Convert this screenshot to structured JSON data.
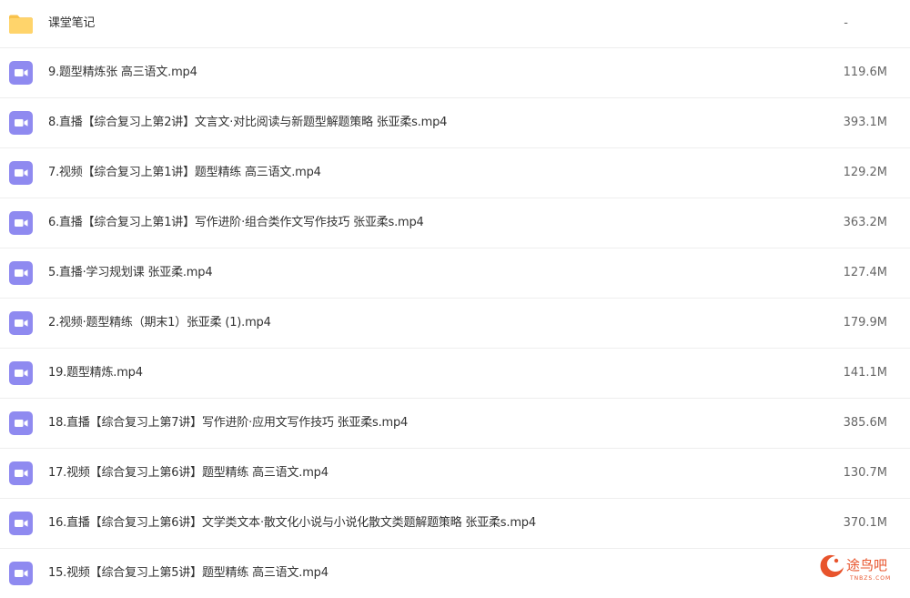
{
  "colors": {
    "folder_icon": "#FFD46B",
    "folder_icon_tab": "#F8C24C",
    "video_icon": "#8F8AF0",
    "row_divider": "#eeeeee",
    "name_text": "#333333",
    "size_text": "#666666"
  },
  "files": [
    {
      "icon": "folder-icon",
      "name": "课堂笔记",
      "size": "-"
    },
    {
      "icon": "video-file-icon",
      "name": "9.题型精炼张 高三语文.mp4",
      "size": "119.6M"
    },
    {
      "icon": "video-file-icon",
      "name": "8.直播【综合复习上第2讲】文言文·对比阅读与新题型解题策略 张亚柔s.mp4",
      "size": "393.1M"
    },
    {
      "icon": "video-file-icon",
      "name": "7.视频【综合复习上第1讲】题型精练 高三语文.mp4",
      "size": "129.2M"
    },
    {
      "icon": "video-file-icon",
      "name": "6.直播【综合复习上第1讲】写作进阶·组合类作文写作技巧 张亚柔s.mp4",
      "size": "363.2M"
    },
    {
      "icon": "video-file-icon",
      "name": "5.直播·学习规划课 张亚柔.mp4",
      "size": "127.4M"
    },
    {
      "icon": "video-file-icon",
      "name": "2.视频·题型精练（期末1）张亚柔 (1).mp4",
      "size": "179.9M"
    },
    {
      "icon": "video-file-icon",
      "name": "19.题型精炼.mp4",
      "size": "141.1M"
    },
    {
      "icon": "video-file-icon",
      "name": "18.直播【综合复习上第7讲】写作进阶·应用文写作技巧 张亚柔s.mp4",
      "size": "385.6M"
    },
    {
      "icon": "video-file-icon",
      "name": "17.视频【综合复习上第6讲】题型精练 高三语文.mp4",
      "size": "130.7M"
    },
    {
      "icon": "video-file-icon",
      "name": "16.直播【综合复习上第6讲】文学类文本·散文化小说与小说化散文类题解题策略 张亚柔s.mp4",
      "size": "370.1M"
    },
    {
      "icon": "video-file-icon",
      "name": "15.视频【综合复习上第5讲】题型精练 高三语文.mp4",
      "size": ""
    }
  ],
  "watermark": {
    "text": "途鸟吧",
    "subtext": "TNBZS.COM",
    "color": "#E8542C"
  }
}
